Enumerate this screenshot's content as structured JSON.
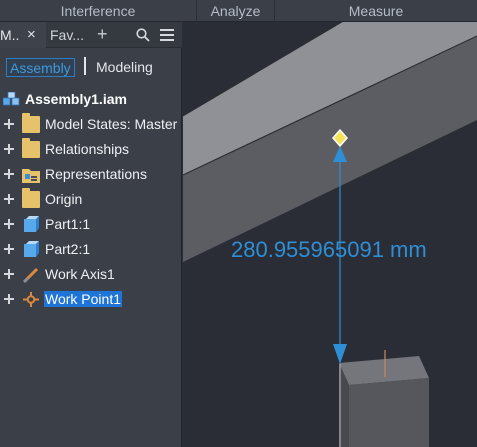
{
  "ribbon": {
    "panels": [
      "Interference",
      "Analyze",
      "Measure"
    ]
  },
  "browser": {
    "tabs": {
      "model_label": "M..",
      "close_symbol": "×",
      "favorites_label": "Fav...",
      "add_symbol": "+"
    },
    "modes": {
      "assembly": "Assembly",
      "modeling": "Modeling"
    },
    "tree": {
      "root": "Assembly1.iam",
      "nodes": [
        {
          "label": "Model States: Master",
          "icon": "folder-icon"
        },
        {
          "label": "Relationships",
          "icon": "folder-icon"
        },
        {
          "label": "Representations",
          "icon": "representations-icon"
        },
        {
          "label": "Origin",
          "icon": "folder-icon"
        },
        {
          "label": "Part1:1",
          "icon": "part-icon"
        },
        {
          "label": "Part2:1",
          "icon": "part-icon"
        },
        {
          "label": "Work Axis1",
          "icon": "work-axis-icon"
        },
        {
          "label": "Work Point1",
          "icon": "work-point-icon",
          "selected": true
        }
      ]
    }
  },
  "viewport": {
    "measurement": "280.955965091 mm",
    "colors": {
      "background": "#2a2d35",
      "part_face": "#5a5c62",
      "dimension": "#2e8fd6",
      "work_point": "#f4e35a"
    }
  }
}
